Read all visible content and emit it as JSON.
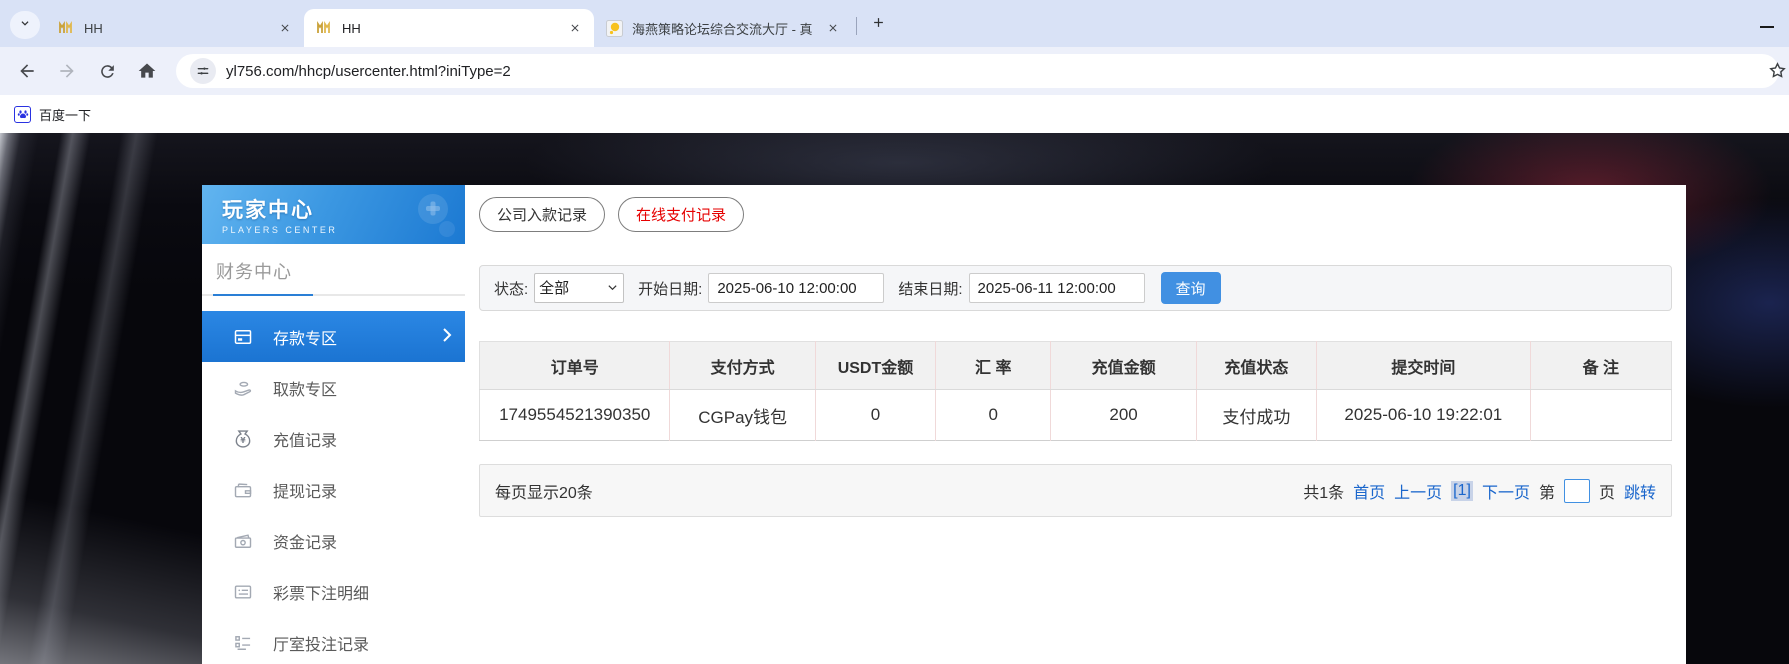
{
  "browser": {
    "tabs": [
      {
        "title": "HH"
      },
      {
        "title": "HH"
      },
      {
        "title": "海燕策略论坛综合交流大厅 - 真"
      }
    ],
    "url": "yl756.com/hhcp/usercenter.html?iniType=2",
    "bookmark_label": "百度一下"
  },
  "sidebar": {
    "title": "玩家中心",
    "subtitle": "PLAYERS CENTER",
    "section": "财务中心",
    "items": [
      {
        "label": "存款专区"
      },
      {
        "label": "取款专区"
      },
      {
        "label": "充值记录"
      },
      {
        "label": "提现记录"
      },
      {
        "label": "资金记录"
      },
      {
        "label": "彩票下注明细"
      },
      {
        "label": "厅室投注记录"
      }
    ]
  },
  "main": {
    "record_tabs": [
      {
        "label": "公司入款记录"
      },
      {
        "label": "在线支付记录"
      }
    ],
    "filter": {
      "status_label": "状态:",
      "status_value": "全部",
      "start_label": "开始日期:",
      "start_value": "2025-06-10 12:00:00",
      "end_label": "结束日期:",
      "end_value": "2025-06-11 12:00:00",
      "search_label": "查询"
    },
    "table": {
      "headers": [
        "订单号",
        "支付方式",
        "USDT金额",
        "汇 率",
        "充值金额",
        "充值状态",
        "提交时间",
        "备 注"
      ],
      "rows": [
        [
          "1749554521390350",
          "CGPay钱包",
          "0",
          "0",
          "200",
          "支付成功",
          "2025-06-10 19:22:01",
          ""
        ]
      ]
    },
    "pagination": {
      "page_size_text": "每页显示20条",
      "total_text": "共1条",
      "first_label": "首页",
      "prev_label": "上一页",
      "current_label": "[1]",
      "next_label": "下一页",
      "jump_pre": "第",
      "jump_post": "页",
      "jump_label": "跳转",
      "jump_value": ""
    }
  },
  "colors": {
    "accent_blue": "#1e7ad6",
    "link_blue": "#1a66cc",
    "red_text": "#e60000",
    "header_gradient_start": "#62b5f0",
    "header_gradient_end": "#1c79d2",
    "table_divider_pink": "#f0d9d9"
  }
}
